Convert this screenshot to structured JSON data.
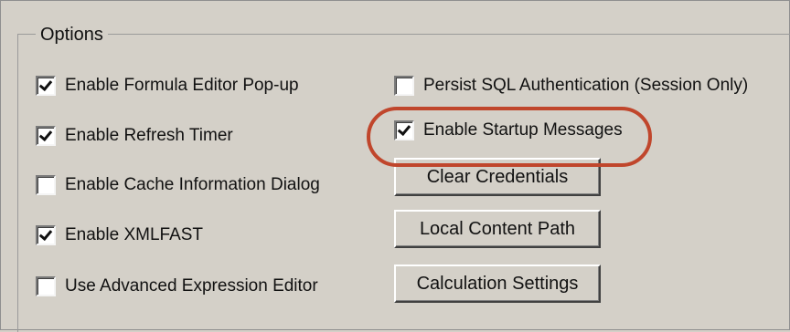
{
  "group": {
    "title": "Options"
  },
  "left_options": [
    {
      "label": "Enable Formula Editor Pop-up",
      "checked": true
    },
    {
      "label": "Enable Refresh Timer",
      "checked": true
    },
    {
      "label": "Enable Cache Information Dialog",
      "checked": false
    },
    {
      "label": "Enable XMLFAST",
      "checked": true
    },
    {
      "label": "Use Advanced Expression Editor",
      "checked": false
    }
  ],
  "right_options": [
    {
      "label": "Persist SQL Authentication (Session Only)",
      "checked": false
    },
    {
      "label": "Enable Startup Messages",
      "checked": true
    }
  ],
  "buttons": {
    "clear_credentials": "Clear Credentials",
    "local_content_path": "Local Content Path",
    "calculation_settings": "Calculation Settings"
  },
  "annotation": {
    "highlight_color": "#c0462c",
    "highlighted_option": "Enable Startup Messages"
  }
}
